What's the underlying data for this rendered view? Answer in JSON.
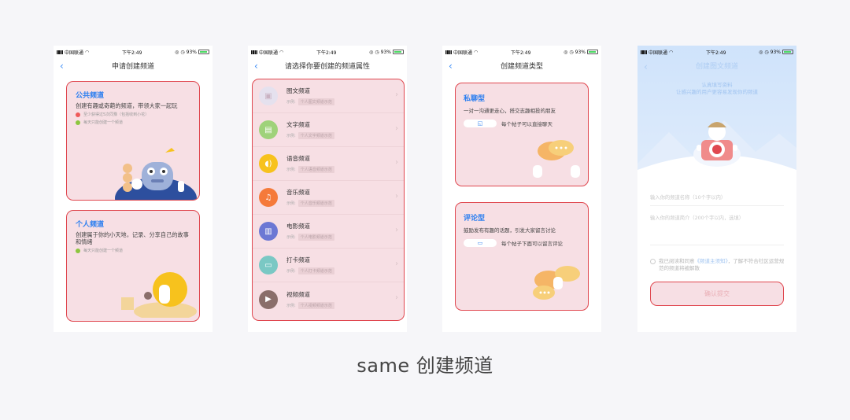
{
  "status": {
    "carrier": "中国联通",
    "time": "下午2:49",
    "battery": "93%"
  },
  "screen1": {
    "title": "申请创建频道",
    "public_card": {
      "title": "公共频道",
      "desc": "创建有趣或奇葩的频道，带领大家一起玩",
      "notes": [
        "至少获得过5次同豫（包括收到小花）",
        "每天只能创建一个频道"
      ]
    },
    "personal_card": {
      "title": "个人频道",
      "desc": "创建属于你的小天地，记录、分享自己的故事和情绪",
      "notes": [
        "每天只能创建一个频道"
      ]
    }
  },
  "screen2": {
    "title": "请选择你要创建的频道属性",
    "example_label": "示例:",
    "rows": [
      {
        "label": "图文频道",
        "example": "个人图文频道示范",
        "icon": "image-icon",
        "color": "#e5e1ee"
      },
      {
        "label": "文字频道",
        "example": "个人文字频道示范",
        "icon": "document-icon",
        "color": "#9fd27a"
      },
      {
        "label": "语音频道",
        "example": "个人语音频道示范",
        "icon": "voice-icon",
        "color": "#f7c21d"
      },
      {
        "label": "音乐频道",
        "example": "个人音乐频道示范",
        "icon": "music-icon",
        "color": "#f57a3a"
      },
      {
        "label": "电影频道",
        "example": "个人电影频道示范",
        "icon": "film-icon",
        "color": "#6c78d4"
      },
      {
        "label": "打卡频道",
        "example": "个人打卡频道示范",
        "icon": "checkin-icon",
        "color": "#7ac8c4"
      },
      {
        "label": "视频频道",
        "example": "个人视频频道示范",
        "icon": "video-icon",
        "color": "#8a6e6a"
      }
    ]
  },
  "screen3": {
    "title": "创建频道类型",
    "private": {
      "title": "私聊型",
      "desc": "一对一沟通更走心，搭交志趣相投的朋友",
      "example": "每个帖子可以直接聊天"
    },
    "comment": {
      "title": "评论型",
      "desc": "鼓励发布有趣的话题，引发大家留言讨论",
      "example": "每个帖子下面可以留言评论"
    }
  },
  "screen4": {
    "title": "创建图文频道",
    "subtitle_line1": "认真填写资料",
    "subtitle_line2": "让感兴趣的用户更容易发现你的频道",
    "name_placeholder": "输入你的频道名称（10个字以内）",
    "intro_placeholder": "输入你的频道简介（200个字以内，选填）",
    "agree_prefix": "我已阅读和同意",
    "agree_link": "《频道主须知》",
    "agree_suffix": "，了解不符合社区运营规范的频道将被解散",
    "submit": "确认提交"
  },
  "caption": "same 创建频道"
}
